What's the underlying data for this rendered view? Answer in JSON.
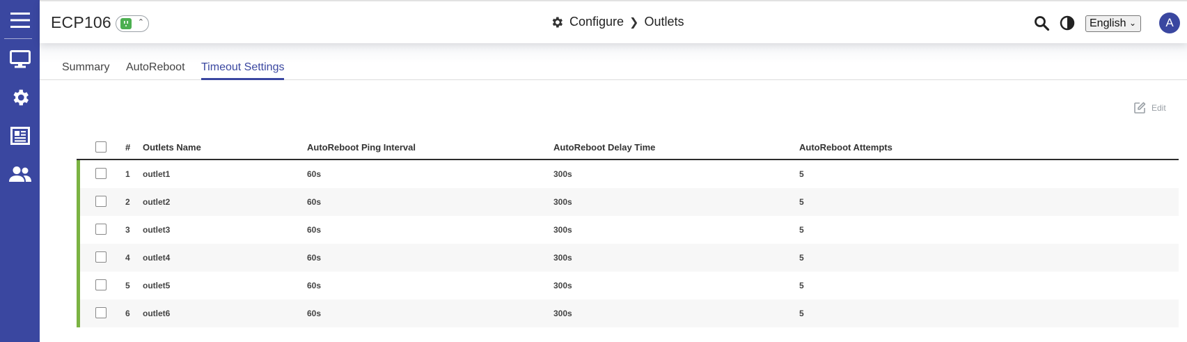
{
  "sidebar": {
    "items": [
      {
        "icon": "menu-icon"
      },
      {
        "icon": "monitor-icon"
      },
      {
        "icon": "gear-icon"
      },
      {
        "icon": "news-icon"
      },
      {
        "icon": "users-icon"
      }
    ],
    "color": "#3a47a0"
  },
  "header": {
    "device_name": "ECP106",
    "status_color": "#4caf50",
    "breadcrumb": {
      "section": "Configure",
      "page": "Outlets"
    },
    "language": "English",
    "avatar_initial": "A"
  },
  "tabs": [
    {
      "label": "Summary",
      "active": false
    },
    {
      "label": "AutoReboot",
      "active": false
    },
    {
      "label": "Timeout Settings",
      "active": true
    }
  ],
  "toolbar": {
    "edit_label": "Edit"
  },
  "table": {
    "columns": [
      "#",
      "Outlets Name",
      "AutoReboot Ping Interval",
      "AutoReboot Delay Time",
      "AutoReboot Attempts"
    ],
    "rows": [
      {
        "num": "1",
        "name": "outlet1",
        "ping": "60s",
        "delay": "300s",
        "attempts": "5"
      },
      {
        "num": "2",
        "name": "outlet2",
        "ping": "60s",
        "delay": "300s",
        "attempts": "5"
      },
      {
        "num": "3",
        "name": "outlet3",
        "ping": "60s",
        "delay": "300s",
        "attempts": "5"
      },
      {
        "num": "4",
        "name": "outlet4",
        "ping": "60s",
        "delay": "300s",
        "attempts": "5"
      },
      {
        "num": "5",
        "name": "outlet5",
        "ping": "60s",
        "delay": "300s",
        "attempts": "5"
      },
      {
        "num": "6",
        "name": "outlet6",
        "ping": "60s",
        "delay": "300s",
        "attempts": "5"
      }
    ],
    "row_indicator_color": "#7bb342"
  }
}
